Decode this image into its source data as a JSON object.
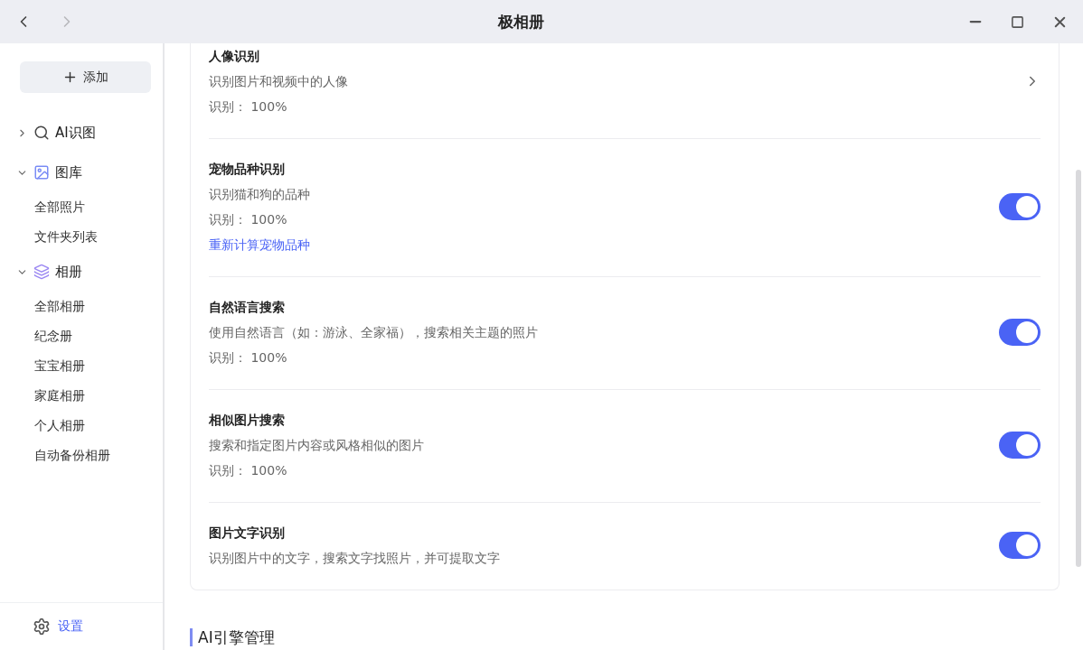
{
  "window": {
    "title": "极相册"
  },
  "sidebar": {
    "add_button": {
      "label": "添加"
    },
    "groups": [
      {
        "label": "AI识图",
        "expanded": false
      },
      {
        "label": "图库",
        "expanded": true,
        "children": [
          {
            "label": "全部照片"
          },
          {
            "label": "文件夹列表"
          }
        ]
      },
      {
        "label": "相册",
        "expanded": true,
        "children": [
          {
            "label": "全部相册"
          },
          {
            "label": "纪念册"
          },
          {
            "label": "宝宝相册"
          },
          {
            "label": "家庭相册"
          },
          {
            "label": "个人相册"
          },
          {
            "label": "自动备份相册"
          }
        ]
      }
    ],
    "settings": {
      "label": "设置"
    }
  },
  "features": [
    {
      "kind": "link",
      "title": "人像识别",
      "description": "识别图片和视频中的人像",
      "status": "识别： 100%"
    },
    {
      "kind": "toggle",
      "title": "宠物品种识别",
      "description": "识别猫和狗的品种",
      "status": "识别： 100%",
      "action": "重新计算宠物品种",
      "on": true
    },
    {
      "kind": "toggle",
      "title": "自然语言搜索",
      "description": "使用自然语言（如：游泳、全家福），搜索相关主题的照片",
      "status": "识别： 100%",
      "on": true
    },
    {
      "kind": "toggle",
      "title": "相似图片搜索",
      "description": "搜索和指定图片内容或风格相似的图片",
      "status": "识别： 100%",
      "on": true
    },
    {
      "kind": "toggle",
      "title": "图片文字识别",
      "description": "识别图片中的文字，搜索文字找照片，并可提取文字",
      "on": true
    }
  ],
  "section_heading": "AI引擎管理"
}
